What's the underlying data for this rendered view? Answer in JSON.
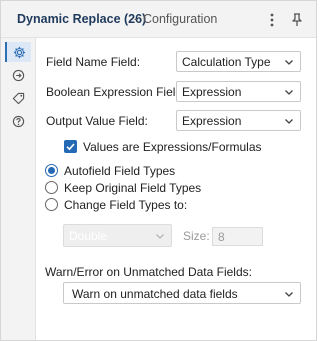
{
  "title": {
    "tool": "Dynamic Replace (26)",
    "separator": "-",
    "section": "Configuration"
  },
  "toolbar_icons": [
    "more-vertical-icon",
    "pin-icon"
  ],
  "sidebar": {
    "items": [
      {
        "icon": "gear-icon",
        "active": true
      },
      {
        "icon": "connections-icon",
        "active": false
      },
      {
        "icon": "tag-icon",
        "active": false
      },
      {
        "icon": "help-icon",
        "active": false
      }
    ]
  },
  "form": {
    "field_name": {
      "label": "Field Name Field:",
      "value": "Calculation Type"
    },
    "boolean_expression": {
      "label": "Boolean Expression Field:",
      "value": "Expression"
    },
    "output_value": {
      "label": "Output Value Field:",
      "value": "Expression"
    },
    "values_are_expressions": {
      "label": "Values are Expressions/Formulas",
      "checked": true
    },
    "field_types": {
      "selected": "autofield",
      "options": [
        {
          "id": "autofield",
          "label": "Autofield Field Types"
        },
        {
          "id": "keep",
          "label": "Keep Original Field Types"
        },
        {
          "id": "change",
          "label": "Change Field Types to:"
        }
      ]
    },
    "change_type": {
      "value": "Double",
      "disabled": true
    },
    "size": {
      "label": "Size:",
      "value": "8",
      "disabled": true
    },
    "unmatched": {
      "label": "Warn/Error on Unmatched Data Fields:",
      "value": "Warn on unmatched data fields"
    }
  },
  "colors": {
    "accent": "#2469b3",
    "title": "#1f3a5c",
    "sidebar_bg": "#f3f3f3"
  }
}
